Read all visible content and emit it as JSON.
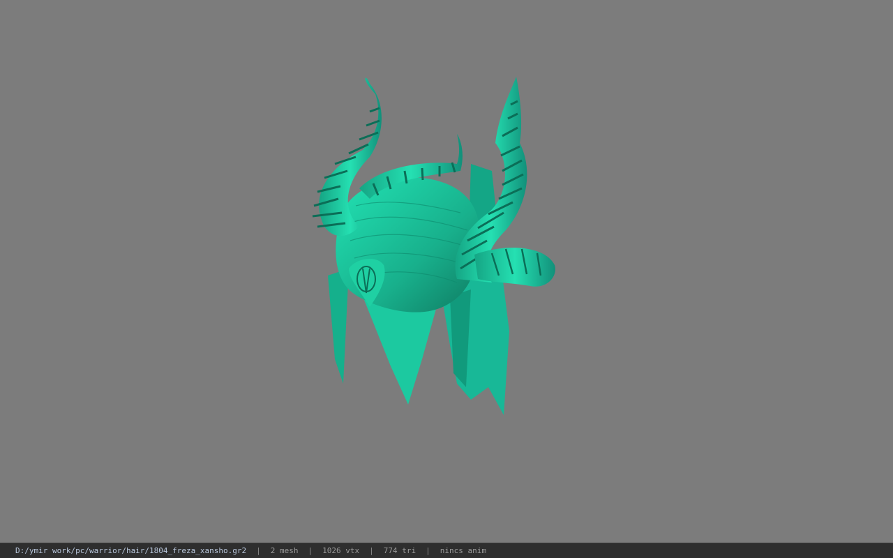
{
  "viewer": {
    "background_color": "#7c7c7c",
    "model_color": "#1fd2a6",
    "model_subject": "horned-hair-mesh"
  },
  "status": {
    "path": "D:/ymir work/pc/warrior/hair/1804_freza_xansho.gr2",
    "mesh": "2 mesh",
    "vtx": "1026 vtx",
    "tri": "774 tri",
    "anim": "nincs anim",
    "separator": "|"
  }
}
